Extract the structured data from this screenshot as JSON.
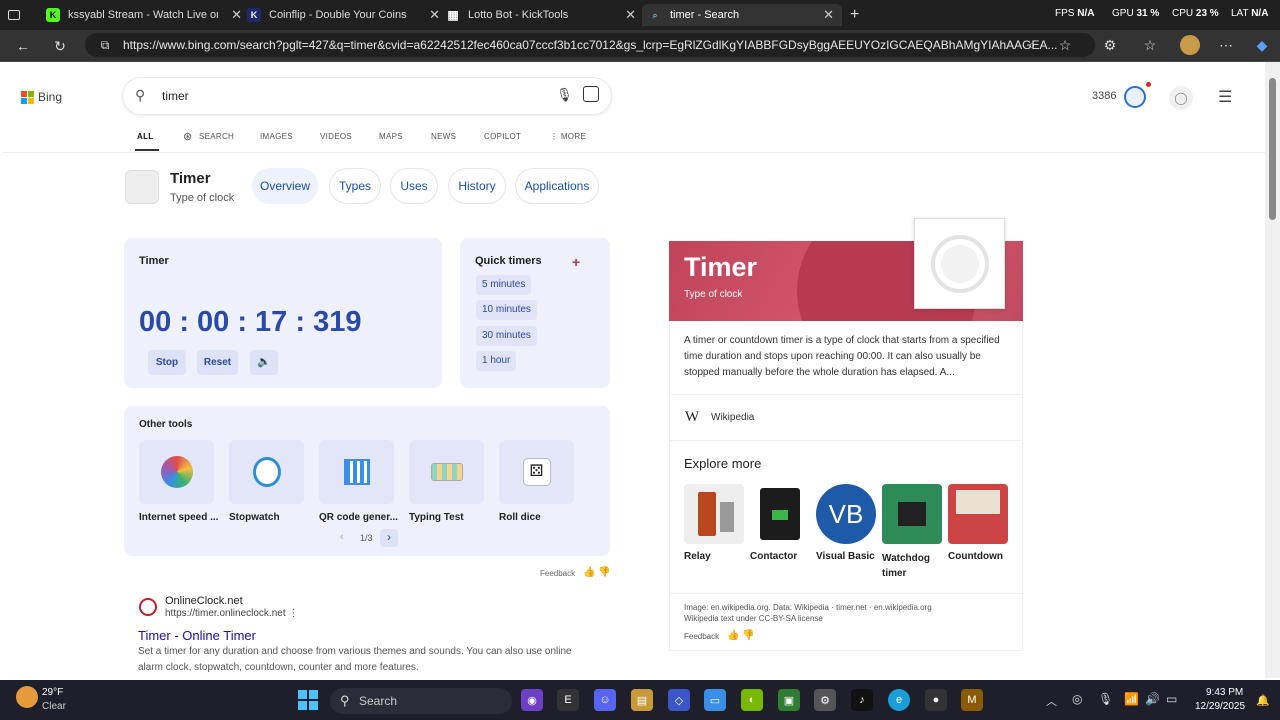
{
  "tabs": [
    {
      "label": "kssyabl Stream - Watch Live on Ki",
      "icon": "kick-icon"
    },
    {
      "label": "Coinflip - Double Your Coins",
      "icon": "coinflip-icon"
    },
    {
      "label": "Lotto Bot - KickTools",
      "icon": "grid-icon"
    },
    {
      "label": "timer - Search",
      "icon": "bing-search-icon"
    }
  ],
  "overlay": {
    "fps_label": "FPS",
    "fps_value": "N/A",
    "gpu_label": "GPU",
    "gpu_value": "31 %",
    "cpu_label": "CPU",
    "cpu_value": "23 %",
    "lat_label": "LAT",
    "lat_value": "N/A"
  },
  "url": "https://www.bing.com/search?pglt=427&q=timer&cvid=a62242512fec460ca07cccf3b1cc7012&gs_lcrp=EgRlZGdlKgYIABBFGDsyBggAEEUYOzIGCAEQABhAMgYIAhAAGEA...",
  "bing": {
    "logo_text": "Bing",
    "query": "timer",
    "points": "3386"
  },
  "nav": [
    "ALL",
    "SEARCH",
    "IMAGES",
    "VIDEOS",
    "MAPS",
    "NEWS",
    "COPILOT",
    "MORE"
  ],
  "entity": {
    "title": "Timer",
    "subtitle": "Type of clock",
    "pills": [
      "Overview",
      "Types",
      "Uses",
      "History",
      "Applications"
    ]
  },
  "timer": {
    "heading": "Timer",
    "display": "00 : 00 : 17 : 319",
    "stop": "Stop",
    "reset": "Reset"
  },
  "quick": {
    "heading": "Quick timers",
    "add": "+",
    "items": [
      "5 minutes",
      "10 minutes",
      "30 minutes",
      "1 hour"
    ]
  },
  "tools": {
    "heading": "Other tools",
    "items": [
      "Internet speed ...",
      "Stopwatch",
      "QR code gener...",
      "Typing Test",
      "Roll dice"
    ],
    "pager": "1/3"
  },
  "feedback_left": "Feedback",
  "result": {
    "site": "OnlineClock.net",
    "url": "https://timer.onlineclock.net",
    "title": "Timer - Online Timer",
    "snippet1": "Set a timer for any duration and choose from various themes and sounds. You can also use online",
    "snippet2": "alarm clock, stopwatch, countdown, counter and more features."
  },
  "kp": {
    "title": "Timer",
    "subtitle": "Type of clock",
    "desc": "A timer or countdown timer is a type of clock that starts from a specified time duration and stops upon reaching 00:00. It can also usually be stopped manually before the whole duration has elapsed. A...",
    "source": "Wikipedia",
    "explore": "Explore more",
    "items": [
      "Relay",
      "Contactor",
      "Visual Basic",
      "Watchdog timer",
      "Countdown"
    ],
    "vb_text": "VB",
    "credit1": "Image: en.wikipedia.org. Data: Wikipedia · timer.net · en.wikipedia.org",
    "credit2": "Wikipedia text under CC-BY-SA license",
    "feedback": "Feedback"
  },
  "taskbar": {
    "temp": "29°F",
    "weather": "Clear",
    "search": "Search",
    "time": "9:43 PM",
    "date": "12/29/2025"
  },
  "colors": {
    "bing_accent": "#2b4aa8",
    "kp_header": "#c8475e",
    "timer_card": "#eef0fb"
  }
}
